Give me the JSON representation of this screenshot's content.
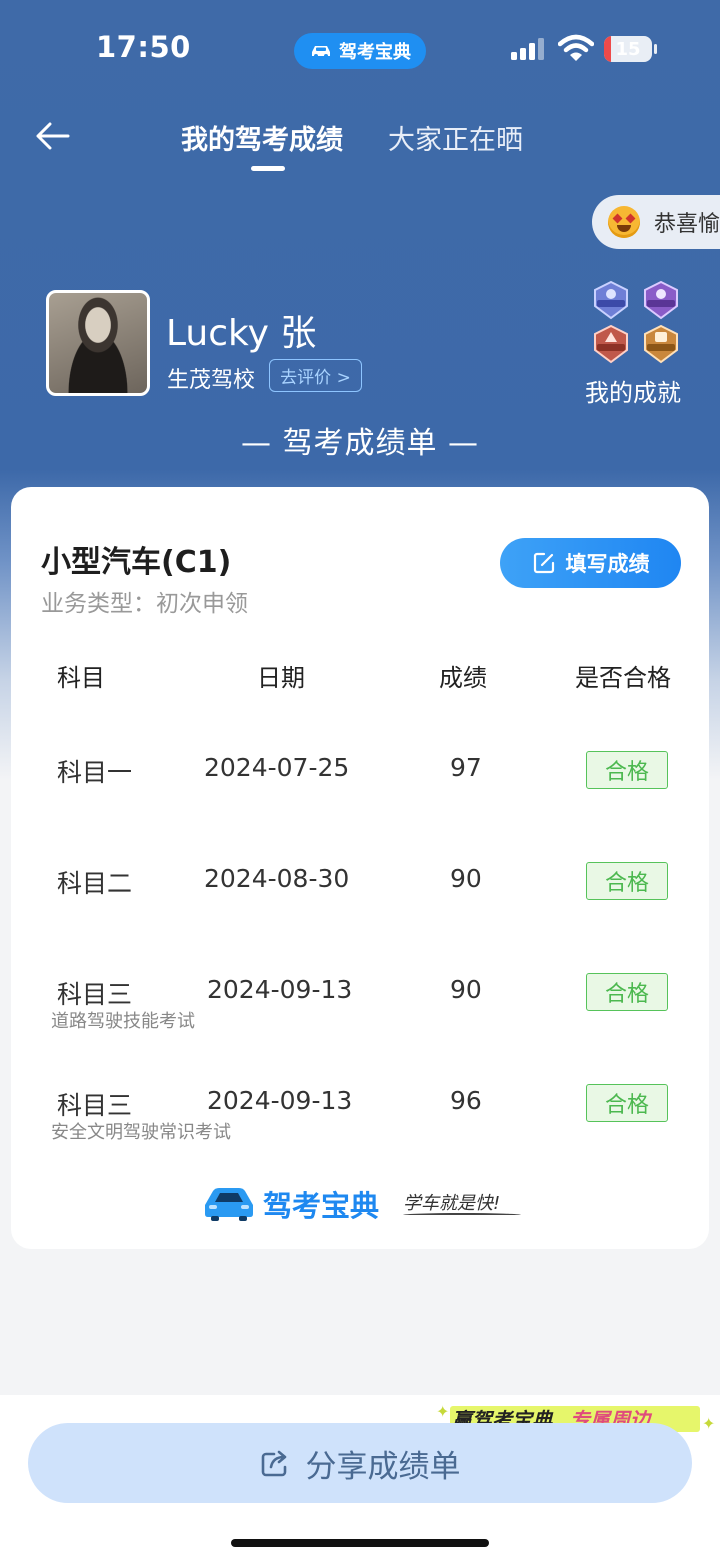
{
  "status_bar": {
    "time": "17:50",
    "app_label": "驾考宝典",
    "battery_level": "15",
    "battery_fraction": 0.15
  },
  "nav": {
    "tabs": [
      {
        "label": "我的驾考成绩",
        "active": true
      },
      {
        "label": "大家正在晒",
        "active": false
      }
    ]
  },
  "congrats_bubble": {
    "text": "恭喜愉"
  },
  "profile": {
    "name": "Lucky 张",
    "school": "生茂驾校",
    "rate_label": "去评价 >",
    "achievements_label": "我的成就",
    "badges": [
      "科目一",
      "科目二",
      "科目三",
      "科目四"
    ]
  },
  "section_title": "— 驾考成绩单 —",
  "report": {
    "vehicle": "小型汽车(C1)",
    "business_type": "业务类型：初次申领",
    "fill_button": "填写成绩",
    "columns": [
      "科目",
      "日期",
      "成绩",
      "是否合格"
    ],
    "rows": [
      {
        "subject": "科目一",
        "note": "",
        "date": "2024-07-25",
        "score": "97",
        "result": "合格"
      },
      {
        "subject": "科目二",
        "note": "",
        "date": "2024-08-30",
        "score": "90",
        "result": "合格"
      },
      {
        "subject": "科目三",
        "note": "道路驾驶技能考试",
        "date": "2024-09-13",
        "score": "90",
        "result": "合格"
      },
      {
        "subject": "科目三",
        "note": "安全文明驾驶常识考试",
        "date": "2024-09-13",
        "score": "96",
        "result": "合格"
      }
    ],
    "brand": {
      "name": "驾考宝典",
      "slogan": "学车就是快!"
    }
  },
  "promo": {
    "text_part1": "赢驾考宝典",
    "text_part2": "专属周边"
  },
  "share_button": "分享成绩单",
  "colors": {
    "header_blue": "#3f6aa8",
    "accent_blue": "#1f86f2",
    "pass_green": "#4cb84f",
    "battery_red": "#ee4a4a"
  }
}
